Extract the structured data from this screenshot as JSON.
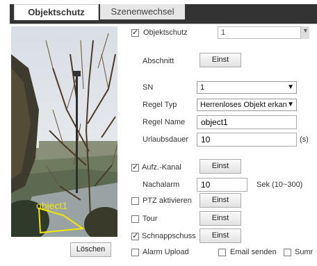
{
  "tabs": {
    "active": "Objektschutz",
    "inactive": "Szenenwechsel"
  },
  "video": {
    "object_label": "object1"
  },
  "form": {
    "objektschutz": {
      "label": "Objektschutz",
      "checked": true,
      "value": "1"
    },
    "abschnitt": {
      "label": "Abschnitt",
      "button": "Einst"
    },
    "sn": {
      "label": "SN",
      "value": "1"
    },
    "regel_typ": {
      "label": "Regel Typ",
      "value": "Herrenloses Objekt erkan"
    },
    "regel_name": {
      "label": "Regel Name",
      "value": "object1"
    },
    "urlaubsdauer": {
      "label": "Urlaubsdauer",
      "value": "10",
      "unit": "(s)"
    },
    "aufz_kanal": {
      "label": "Aufz.-Kanal",
      "checked": true,
      "button": "Einst"
    },
    "nachalarm": {
      "label": "Nachalarm",
      "value": "10",
      "unit": "Sek (10~300)"
    },
    "ptz": {
      "label": "PTZ aktivieren",
      "checked": false,
      "button": "Einst"
    },
    "tour": {
      "label": "Tour",
      "checked": false,
      "button": "Einst"
    },
    "schnappschuss": {
      "label": "Schnappschuss",
      "checked": true,
      "button": "Einst"
    },
    "alarm_upload": {
      "label": "Alarm Upload",
      "checked": false
    },
    "email": {
      "label": "Email senden",
      "checked": false
    },
    "summer": {
      "label": "Sumr",
      "checked": false
    }
  },
  "delete_button": "Löschen",
  "check_glyph": "✓"
}
